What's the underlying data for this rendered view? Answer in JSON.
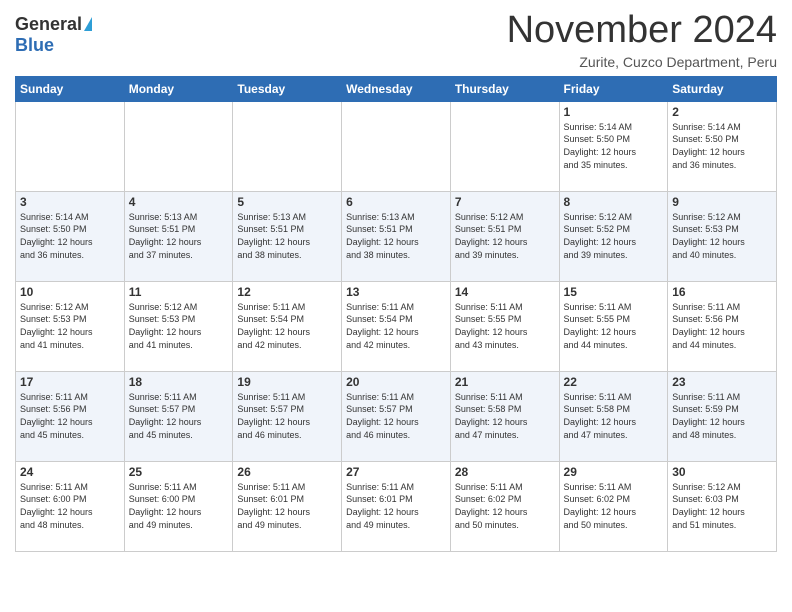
{
  "logo": {
    "general": "General",
    "blue": "Blue"
  },
  "header": {
    "month": "November 2024",
    "location": "Zurite, Cuzco Department, Peru"
  },
  "weekdays": [
    "Sunday",
    "Monday",
    "Tuesday",
    "Wednesday",
    "Thursday",
    "Friday",
    "Saturday"
  ],
  "weeks": [
    [
      {
        "day": "",
        "info": ""
      },
      {
        "day": "",
        "info": ""
      },
      {
        "day": "",
        "info": ""
      },
      {
        "day": "",
        "info": ""
      },
      {
        "day": "",
        "info": ""
      },
      {
        "day": "1",
        "info": "Sunrise: 5:14 AM\nSunset: 5:50 PM\nDaylight: 12 hours\nand 35 minutes."
      },
      {
        "day": "2",
        "info": "Sunrise: 5:14 AM\nSunset: 5:50 PM\nDaylight: 12 hours\nand 36 minutes."
      }
    ],
    [
      {
        "day": "3",
        "info": "Sunrise: 5:14 AM\nSunset: 5:50 PM\nDaylight: 12 hours\nand 36 minutes."
      },
      {
        "day": "4",
        "info": "Sunrise: 5:13 AM\nSunset: 5:51 PM\nDaylight: 12 hours\nand 37 minutes."
      },
      {
        "day": "5",
        "info": "Sunrise: 5:13 AM\nSunset: 5:51 PM\nDaylight: 12 hours\nand 38 minutes."
      },
      {
        "day": "6",
        "info": "Sunrise: 5:13 AM\nSunset: 5:51 PM\nDaylight: 12 hours\nand 38 minutes."
      },
      {
        "day": "7",
        "info": "Sunrise: 5:12 AM\nSunset: 5:51 PM\nDaylight: 12 hours\nand 39 minutes."
      },
      {
        "day": "8",
        "info": "Sunrise: 5:12 AM\nSunset: 5:52 PM\nDaylight: 12 hours\nand 39 minutes."
      },
      {
        "day": "9",
        "info": "Sunrise: 5:12 AM\nSunset: 5:53 PM\nDaylight: 12 hours\nand 40 minutes."
      }
    ],
    [
      {
        "day": "10",
        "info": "Sunrise: 5:12 AM\nSunset: 5:53 PM\nDaylight: 12 hours\nand 41 minutes."
      },
      {
        "day": "11",
        "info": "Sunrise: 5:12 AM\nSunset: 5:53 PM\nDaylight: 12 hours\nand 41 minutes."
      },
      {
        "day": "12",
        "info": "Sunrise: 5:11 AM\nSunset: 5:54 PM\nDaylight: 12 hours\nand 42 minutes."
      },
      {
        "day": "13",
        "info": "Sunrise: 5:11 AM\nSunset: 5:54 PM\nDaylight: 12 hours\nand 42 minutes."
      },
      {
        "day": "14",
        "info": "Sunrise: 5:11 AM\nSunset: 5:55 PM\nDaylight: 12 hours\nand 43 minutes."
      },
      {
        "day": "15",
        "info": "Sunrise: 5:11 AM\nSunset: 5:55 PM\nDaylight: 12 hours\nand 44 minutes."
      },
      {
        "day": "16",
        "info": "Sunrise: 5:11 AM\nSunset: 5:56 PM\nDaylight: 12 hours\nand 44 minutes."
      }
    ],
    [
      {
        "day": "17",
        "info": "Sunrise: 5:11 AM\nSunset: 5:56 PM\nDaylight: 12 hours\nand 45 minutes."
      },
      {
        "day": "18",
        "info": "Sunrise: 5:11 AM\nSunset: 5:57 PM\nDaylight: 12 hours\nand 45 minutes."
      },
      {
        "day": "19",
        "info": "Sunrise: 5:11 AM\nSunset: 5:57 PM\nDaylight: 12 hours\nand 46 minutes."
      },
      {
        "day": "20",
        "info": "Sunrise: 5:11 AM\nSunset: 5:57 PM\nDaylight: 12 hours\nand 46 minutes."
      },
      {
        "day": "21",
        "info": "Sunrise: 5:11 AM\nSunset: 5:58 PM\nDaylight: 12 hours\nand 47 minutes."
      },
      {
        "day": "22",
        "info": "Sunrise: 5:11 AM\nSunset: 5:58 PM\nDaylight: 12 hours\nand 47 minutes."
      },
      {
        "day": "23",
        "info": "Sunrise: 5:11 AM\nSunset: 5:59 PM\nDaylight: 12 hours\nand 48 minutes."
      }
    ],
    [
      {
        "day": "24",
        "info": "Sunrise: 5:11 AM\nSunset: 6:00 PM\nDaylight: 12 hours\nand 48 minutes."
      },
      {
        "day": "25",
        "info": "Sunrise: 5:11 AM\nSunset: 6:00 PM\nDaylight: 12 hours\nand 49 minutes."
      },
      {
        "day": "26",
        "info": "Sunrise: 5:11 AM\nSunset: 6:01 PM\nDaylight: 12 hours\nand 49 minutes."
      },
      {
        "day": "27",
        "info": "Sunrise: 5:11 AM\nSunset: 6:01 PM\nDaylight: 12 hours\nand 49 minutes."
      },
      {
        "day": "28",
        "info": "Sunrise: 5:11 AM\nSunset: 6:02 PM\nDaylight: 12 hours\nand 50 minutes."
      },
      {
        "day": "29",
        "info": "Sunrise: 5:11 AM\nSunset: 6:02 PM\nDaylight: 12 hours\nand 50 minutes."
      },
      {
        "day": "30",
        "info": "Sunrise: 5:12 AM\nSunset: 6:03 PM\nDaylight: 12 hours\nand 51 minutes."
      }
    ]
  ]
}
